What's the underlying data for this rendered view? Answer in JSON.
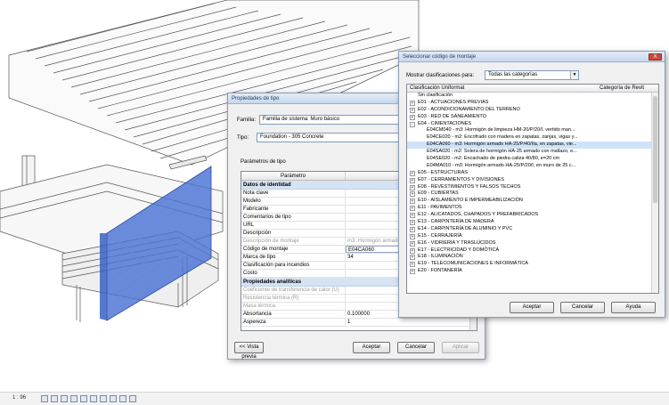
{
  "statusbar": {
    "scale": "1 : 96"
  },
  "props_dialog": {
    "title": "Propiedades de tipo",
    "family_label": "Familia:",
    "family_value": "Familia de sistema: Muro básico",
    "type_label": "Tipo:",
    "type_value": "Foundation - 305 Concrete",
    "params_label": "Parámetros de tipo",
    "col_param": "Parámetro",
    "col_value": "Valor",
    "groups": [
      {
        "name": "Datos de identidad",
        "rows": [
          {
            "param": "Nota clave",
            "value": ""
          },
          {
            "param": "Modelo",
            "value": ""
          },
          {
            "param": "Fabricante",
            "value": ""
          },
          {
            "param": "Comentarios de tipo",
            "value": ""
          },
          {
            "param": "URL",
            "value": ""
          },
          {
            "param": "Descripción",
            "value": ""
          },
          {
            "param": "Descripción de montaje",
            "value": "m3: Hormigón armado HA-25/P/40/IIa, en zapatas"
          },
          {
            "param": "Código de montaje",
            "value": "E04CA060"
          },
          {
            "param": "Marca de tipo",
            "value": "34"
          },
          {
            "param": "Clasificación para incendios",
            "value": ""
          },
          {
            "param": "Costo",
            "value": ""
          }
        ]
      },
      {
        "name": "Propiedades analíticas",
        "rows": [
          {
            "param": "Coeficiente de transferencia de calor (U)",
            "value": ""
          },
          {
            "param": "Resistencia térmica (R)",
            "value": ""
          },
          {
            "param": "Masa térmica",
            "value": ""
          },
          {
            "param": "Absortancia",
            "value": "0.100000"
          },
          {
            "param": "Aspereza",
            "value": "1"
          }
        ]
      }
    ],
    "preview_btn": "<< Vista previa",
    "ok_btn": "Aceptar",
    "cancel_btn": "Cancelar",
    "apply_btn": "Aplicar"
  },
  "cls_dialog": {
    "title": "Seleccionar código de montaje",
    "close_label": "X",
    "filter_label": "Mostrar clasificaciones para:",
    "filter_value": "Todas las categorías",
    "col_class": "Clasificación Uniformat",
    "col_cat": "Categoría de Revit",
    "nodes": [
      {
        "label": "Sin clasificación",
        "level": 0,
        "exp": ""
      },
      {
        "label": "E01 - ACTUACIONES PREVIAS",
        "level": 0,
        "exp": "+"
      },
      {
        "label": "E02 - ACONDICIONAMIENTO DEL TERRENO",
        "level": 0,
        "exp": "+"
      },
      {
        "label": "E03 - RED DE SANEAMIENTO",
        "level": 0,
        "exp": "+"
      },
      {
        "label": "E04 - CIMENTACIONES",
        "level": 0,
        "exp": "-"
      },
      {
        "label": "E04CM040 - m3: Hormigón de limpieza HM-20/P/20/I, vertido man...",
        "level": 1,
        "exp": ""
      },
      {
        "label": "E04CE020 - m2: Encofrado con madera en zapatas, zanjas, vigas y...",
        "level": 1,
        "exp": ""
      },
      {
        "label": "E04CA060 - m3: Hormigón armado HA-25/P/40/IIa, en zapatas, vie...",
        "level": 1,
        "exp": "",
        "selected": true
      },
      {
        "label": "E04SA020 - m2: Solera de hormigón HA-25 armado con mallazo, e...",
        "level": 1,
        "exp": ""
      },
      {
        "label": "E04SE020 - m2: Encachado de piedra caliza 40/80, e=20 cm",
        "level": 1,
        "exp": ""
      },
      {
        "label": "E04MA010 - m3: Hormigón armado HA-25/P/20/I, en muro de 25 c...",
        "level": 1,
        "exp": ""
      },
      {
        "label": "E05 - ESTRUCTURAS",
        "level": 0,
        "exp": "+"
      },
      {
        "label": "E07 - CERRAMIENTOS Y DIVISIONES",
        "level": 0,
        "exp": "+"
      },
      {
        "label": "E08 - REVESTIMIENTOS Y FALSOS TECHOS",
        "level": 0,
        "exp": "+"
      },
      {
        "label": "E09 - CUBIERTAS",
        "level": 0,
        "exp": "+"
      },
      {
        "label": "E10 - AISLAMIENTO E IMPERMEABILIZACIÓN",
        "level": 0,
        "exp": "+"
      },
      {
        "label": "E11 - PAVIMENTOS",
        "level": 0,
        "exp": "+"
      },
      {
        "label": "E12 - ALICATADOS, CHAPADOS Y PREFABRICADOS",
        "level": 0,
        "exp": "+"
      },
      {
        "label": "E13 - CARPINTERÍA DE MADERA",
        "level": 0,
        "exp": "+"
      },
      {
        "label": "E14 - CARPINTERÍA DE ALUMINIO Y PVC",
        "level": 0,
        "exp": "+"
      },
      {
        "label": "E15 - CERRAJERÍA",
        "level": 0,
        "exp": "+"
      },
      {
        "label": "E16 - VIDRIERÍA Y TRASLÚCIDOS",
        "level": 0,
        "exp": "+"
      },
      {
        "label": "E17 - ELECTRICIDAD Y DOMÓTICA",
        "level": 0,
        "exp": "+"
      },
      {
        "label": "E18 - ILUMINACIÓN",
        "level": 0,
        "exp": "+"
      },
      {
        "label": "E19 - TELECOMUNICACIONES E INFORMÁTICA",
        "level": 0,
        "exp": "+"
      },
      {
        "label": "E20 - FONTANERÍA",
        "level": 0,
        "exp": "+"
      }
    ],
    "ok_btn": "Aceptar",
    "cancel_btn": "Cancelar",
    "help_btn": "Ayuda"
  },
  "colors": {
    "highlight_wall": "#4a73d6",
    "selection": "#cfe3f8",
    "group_bg": "#d6e3f3"
  }
}
